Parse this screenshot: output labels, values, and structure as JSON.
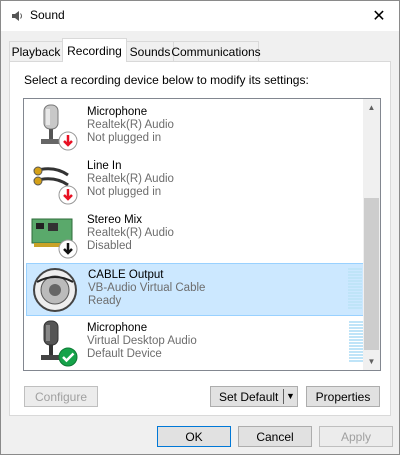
{
  "window": {
    "title": "Sound",
    "close_glyph": "✕"
  },
  "tabs": [
    {
      "label": "Playback",
      "active": false
    },
    {
      "label": "Recording",
      "active": true
    },
    {
      "label": "Sounds",
      "active": false
    },
    {
      "label": "Communications",
      "active": false
    }
  ],
  "instructions": "Select a recording device below to modify its settings:",
  "devices": [
    {
      "name": "Microphone",
      "driver": "Realtek(R) Audio",
      "status": "Not plugged in",
      "icon": "microphone-icon",
      "badge": "red-down-arrow",
      "selected": false,
      "meter": false
    },
    {
      "name": "Line In",
      "driver": "Realtek(R) Audio",
      "status": "Not plugged in",
      "icon": "line-in-icon",
      "badge": "red-down-arrow",
      "selected": false,
      "meter": false
    },
    {
      "name": "Stereo Mix",
      "driver": "Realtek(R) Audio",
      "status": "Disabled",
      "icon": "sound-card-icon",
      "badge": "black-down-arrow",
      "selected": false,
      "meter": false
    },
    {
      "name": "CABLE Output",
      "driver": "VB-Audio Virtual Cable",
      "status": "Ready",
      "icon": "cable-icon",
      "badge": "none",
      "selected": true,
      "meter": true
    },
    {
      "name": "Microphone",
      "driver": "Virtual Desktop Audio",
      "status": "Default Device",
      "icon": "microphone-icon",
      "badge": "green-check",
      "selected": false,
      "meter": true
    }
  ],
  "buttons": {
    "configure": "Configure",
    "set_default": "Set Default",
    "properties": "Properties",
    "ok": "OK",
    "cancel": "Cancel",
    "apply": "Apply"
  },
  "colors": {
    "selection": "#cce8ff",
    "selection_border": "#99d1ff",
    "accent": "#0078d7",
    "error": "#e81123",
    "success": "#16a34a"
  }
}
